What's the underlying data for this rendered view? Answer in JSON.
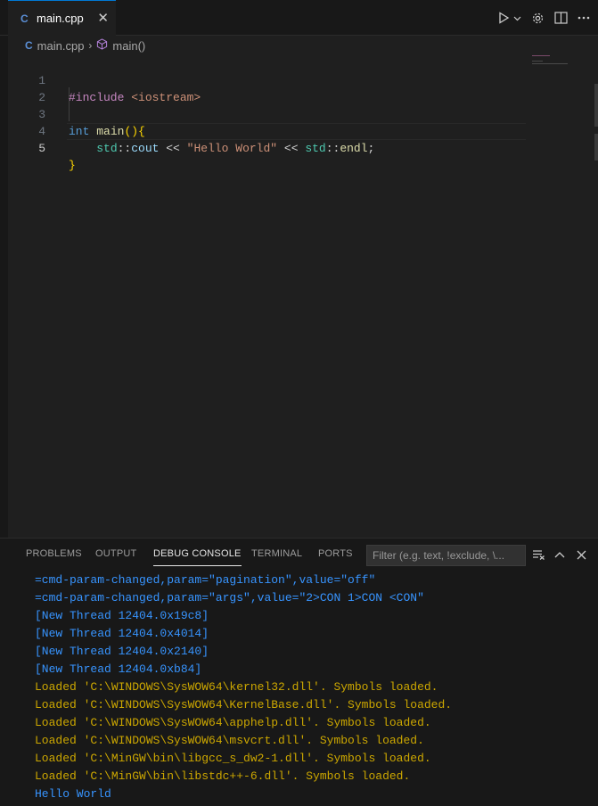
{
  "tab": {
    "label": "main.cpp",
    "icon": "C",
    "close": "✕"
  },
  "breadcrumb": {
    "file": "main.cpp",
    "symbol": "main()"
  },
  "editor": {
    "line_numbers": [
      "1",
      "2",
      "3",
      "4",
      "5"
    ],
    "lines": [
      {
        "t1": "#include ",
        "t2": "<iostream>"
      },
      {},
      {
        "t1": "int",
        "t2": " ",
        "t3": "main",
        "t4": "()",
        "t5": "{"
      },
      {
        "t1": "    ",
        "t2": "std",
        "t3": "::",
        "t4": "cout",
        "t5": " << ",
        "t6": "\"Hello World\"",
        "t7": " << ",
        "t8": "std",
        "t9": "::",
        "t10": "endl",
        "t11": ";"
      },
      {
        "t1": "}"
      }
    ]
  },
  "panel": {
    "tabs": [
      "PROBLEMS",
      "OUTPUT",
      "DEBUG CONSOLE",
      "TERMINAL",
      "PORTS"
    ],
    "active_tab": "DEBUG CONSOLE",
    "filter_placeholder": "Filter (e.g. text, !exclude, \\...",
    "console_lines": [
      "=cmd-param-changed,param=\"pagination\",value=\"off\"",
      "=cmd-param-changed,param=\"args\",value=\"2>CON 1>CON <CON\"",
      "[New Thread 12404.0x19c8]",
      "[New Thread 12404.0x4014]",
      "[New Thread 12404.0x2140]",
      "[New Thread 12404.0xb84]",
      "Loaded 'C:\\WINDOWS\\SysWOW64\\kernel32.dll'. Symbols loaded.",
      "Loaded 'C:\\WINDOWS\\SysWOW64\\KernelBase.dll'. Symbols loaded.",
      "Loaded 'C:\\WINDOWS\\SysWOW64\\apphelp.dll'. Symbols loaded.",
      "Loaded 'C:\\WINDOWS\\SysWOW64\\msvcrt.dll'. Symbols loaded.",
      "Loaded 'C:\\MinGW\\bin\\libgcc_s_dw2-1.dll'. Symbols loaded.",
      "Loaded 'C:\\MinGW\\bin\\libstdc++-6.dll'. Symbols loaded.",
      "Hello World"
    ]
  },
  "colors": {
    "accent": "#0078d4",
    "console_blue": "#3794ff",
    "console_orange": "#cca700"
  }
}
